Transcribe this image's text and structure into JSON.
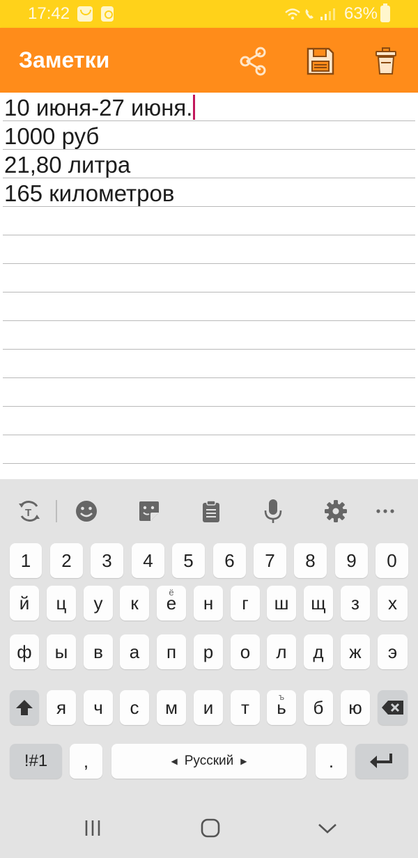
{
  "status_bar": {
    "time": "17:42",
    "battery": "63%",
    "icons": [
      "mail-notification-icon",
      "photo-notification-icon",
      "wifi-icon",
      "call-icon",
      "signal-icon",
      "battery-icon"
    ]
  },
  "app_bar": {
    "title": "Заметки",
    "actions": [
      "share-icon",
      "save-icon",
      "delete-icon"
    ],
    "color": "#FF8C1A"
  },
  "note": {
    "lines": [
      "10 июня-27 июня.",
      "1000 руб",
      "21,80 литра",
      "165 километров",
      "",
      "",
      "",
      "",
      "",
      "",
      "",
      "",
      ""
    ]
  },
  "keyboard": {
    "toolbar": [
      "text-convert-icon",
      "emoji-icon",
      "sticker-icon",
      "clipboard-icon",
      "microphone-icon",
      "settings-icon",
      "more-icon"
    ],
    "rows": {
      "numbers": [
        "1",
        "2",
        "3",
        "4",
        "5",
        "6",
        "7",
        "8",
        "9",
        "0"
      ],
      "row1": [
        "й",
        "ц",
        "у",
        "к",
        "е",
        "н",
        "г",
        "ш",
        "щ",
        "з",
        "х"
      ],
      "row2": [
        "ф",
        "ы",
        "в",
        "а",
        "п",
        "р",
        "о",
        "л",
        "д",
        "ж",
        "э"
      ],
      "row3": [
        "я",
        "ч",
        "с",
        "м",
        "и",
        "т",
        "ь",
        "б",
        "ю"
      ]
    },
    "hints": {
      "e": "ё",
      "soft_sign": "ъ"
    },
    "symbols_label": "!#1",
    "comma": ",",
    "language": "Русский",
    "period": "."
  },
  "navbar": [
    "recent-apps-icon",
    "home-icon",
    "back-icon"
  ]
}
